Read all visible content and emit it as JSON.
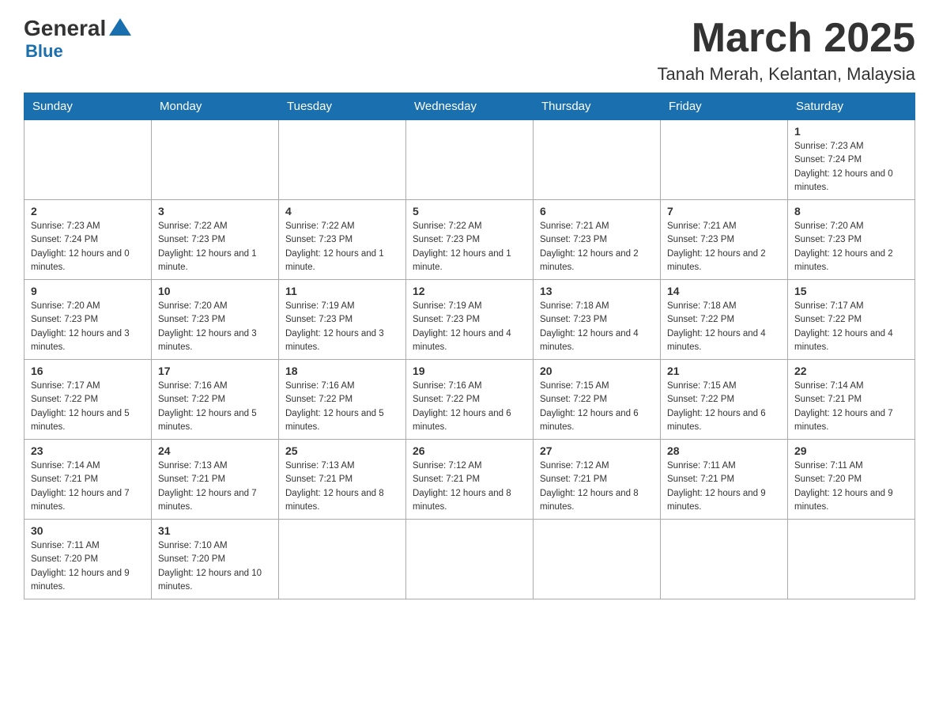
{
  "header": {
    "logo": {
      "general": "General",
      "blue": "Blue"
    },
    "title": "March 2025",
    "location": "Tanah Merah, Kelantan, Malaysia"
  },
  "days_of_week": [
    "Sunday",
    "Monday",
    "Tuesday",
    "Wednesday",
    "Thursday",
    "Friday",
    "Saturday"
  ],
  "weeks": [
    [
      null,
      null,
      null,
      null,
      null,
      null,
      {
        "day": "1",
        "sunrise": "Sunrise: 7:23 AM",
        "sunset": "Sunset: 7:24 PM",
        "daylight": "Daylight: 12 hours and 0 minutes."
      }
    ],
    [
      {
        "day": "2",
        "sunrise": "Sunrise: 7:23 AM",
        "sunset": "Sunset: 7:24 PM",
        "daylight": "Daylight: 12 hours and 0 minutes."
      },
      {
        "day": "3",
        "sunrise": "Sunrise: 7:22 AM",
        "sunset": "Sunset: 7:23 PM",
        "daylight": "Daylight: 12 hours and 1 minute."
      },
      {
        "day": "4",
        "sunrise": "Sunrise: 7:22 AM",
        "sunset": "Sunset: 7:23 PM",
        "daylight": "Daylight: 12 hours and 1 minute."
      },
      {
        "day": "5",
        "sunrise": "Sunrise: 7:22 AM",
        "sunset": "Sunset: 7:23 PM",
        "daylight": "Daylight: 12 hours and 1 minute."
      },
      {
        "day": "6",
        "sunrise": "Sunrise: 7:21 AM",
        "sunset": "Sunset: 7:23 PM",
        "daylight": "Daylight: 12 hours and 2 minutes."
      },
      {
        "day": "7",
        "sunrise": "Sunrise: 7:21 AM",
        "sunset": "Sunset: 7:23 PM",
        "daylight": "Daylight: 12 hours and 2 minutes."
      },
      {
        "day": "8",
        "sunrise": "Sunrise: 7:20 AM",
        "sunset": "Sunset: 7:23 PM",
        "daylight": "Daylight: 12 hours and 2 minutes."
      }
    ],
    [
      {
        "day": "9",
        "sunrise": "Sunrise: 7:20 AM",
        "sunset": "Sunset: 7:23 PM",
        "daylight": "Daylight: 12 hours and 3 minutes."
      },
      {
        "day": "10",
        "sunrise": "Sunrise: 7:20 AM",
        "sunset": "Sunset: 7:23 PM",
        "daylight": "Daylight: 12 hours and 3 minutes."
      },
      {
        "day": "11",
        "sunrise": "Sunrise: 7:19 AM",
        "sunset": "Sunset: 7:23 PM",
        "daylight": "Daylight: 12 hours and 3 minutes."
      },
      {
        "day": "12",
        "sunrise": "Sunrise: 7:19 AM",
        "sunset": "Sunset: 7:23 PM",
        "daylight": "Daylight: 12 hours and 4 minutes."
      },
      {
        "day": "13",
        "sunrise": "Sunrise: 7:18 AM",
        "sunset": "Sunset: 7:23 PM",
        "daylight": "Daylight: 12 hours and 4 minutes."
      },
      {
        "day": "14",
        "sunrise": "Sunrise: 7:18 AM",
        "sunset": "Sunset: 7:22 PM",
        "daylight": "Daylight: 12 hours and 4 minutes."
      },
      {
        "day": "15",
        "sunrise": "Sunrise: 7:17 AM",
        "sunset": "Sunset: 7:22 PM",
        "daylight": "Daylight: 12 hours and 4 minutes."
      }
    ],
    [
      {
        "day": "16",
        "sunrise": "Sunrise: 7:17 AM",
        "sunset": "Sunset: 7:22 PM",
        "daylight": "Daylight: 12 hours and 5 minutes."
      },
      {
        "day": "17",
        "sunrise": "Sunrise: 7:16 AM",
        "sunset": "Sunset: 7:22 PM",
        "daylight": "Daylight: 12 hours and 5 minutes."
      },
      {
        "day": "18",
        "sunrise": "Sunrise: 7:16 AM",
        "sunset": "Sunset: 7:22 PM",
        "daylight": "Daylight: 12 hours and 5 minutes."
      },
      {
        "day": "19",
        "sunrise": "Sunrise: 7:16 AM",
        "sunset": "Sunset: 7:22 PM",
        "daylight": "Daylight: 12 hours and 6 minutes."
      },
      {
        "day": "20",
        "sunrise": "Sunrise: 7:15 AM",
        "sunset": "Sunset: 7:22 PM",
        "daylight": "Daylight: 12 hours and 6 minutes."
      },
      {
        "day": "21",
        "sunrise": "Sunrise: 7:15 AM",
        "sunset": "Sunset: 7:22 PM",
        "daylight": "Daylight: 12 hours and 6 minutes."
      },
      {
        "day": "22",
        "sunrise": "Sunrise: 7:14 AM",
        "sunset": "Sunset: 7:21 PM",
        "daylight": "Daylight: 12 hours and 7 minutes."
      }
    ],
    [
      {
        "day": "23",
        "sunrise": "Sunrise: 7:14 AM",
        "sunset": "Sunset: 7:21 PM",
        "daylight": "Daylight: 12 hours and 7 minutes."
      },
      {
        "day": "24",
        "sunrise": "Sunrise: 7:13 AM",
        "sunset": "Sunset: 7:21 PM",
        "daylight": "Daylight: 12 hours and 7 minutes."
      },
      {
        "day": "25",
        "sunrise": "Sunrise: 7:13 AM",
        "sunset": "Sunset: 7:21 PM",
        "daylight": "Daylight: 12 hours and 8 minutes."
      },
      {
        "day": "26",
        "sunrise": "Sunrise: 7:12 AM",
        "sunset": "Sunset: 7:21 PM",
        "daylight": "Daylight: 12 hours and 8 minutes."
      },
      {
        "day": "27",
        "sunrise": "Sunrise: 7:12 AM",
        "sunset": "Sunset: 7:21 PM",
        "daylight": "Daylight: 12 hours and 8 minutes."
      },
      {
        "day": "28",
        "sunrise": "Sunrise: 7:11 AM",
        "sunset": "Sunset: 7:21 PM",
        "daylight": "Daylight: 12 hours and 9 minutes."
      },
      {
        "day": "29",
        "sunrise": "Sunrise: 7:11 AM",
        "sunset": "Sunset: 7:20 PM",
        "daylight": "Daylight: 12 hours and 9 minutes."
      }
    ],
    [
      {
        "day": "30",
        "sunrise": "Sunrise: 7:11 AM",
        "sunset": "Sunset: 7:20 PM",
        "daylight": "Daylight: 12 hours and 9 minutes."
      },
      {
        "day": "31",
        "sunrise": "Sunrise: 7:10 AM",
        "sunset": "Sunset: 7:20 PM",
        "daylight": "Daylight: 12 hours and 10 minutes."
      },
      null,
      null,
      null,
      null,
      null
    ]
  ]
}
